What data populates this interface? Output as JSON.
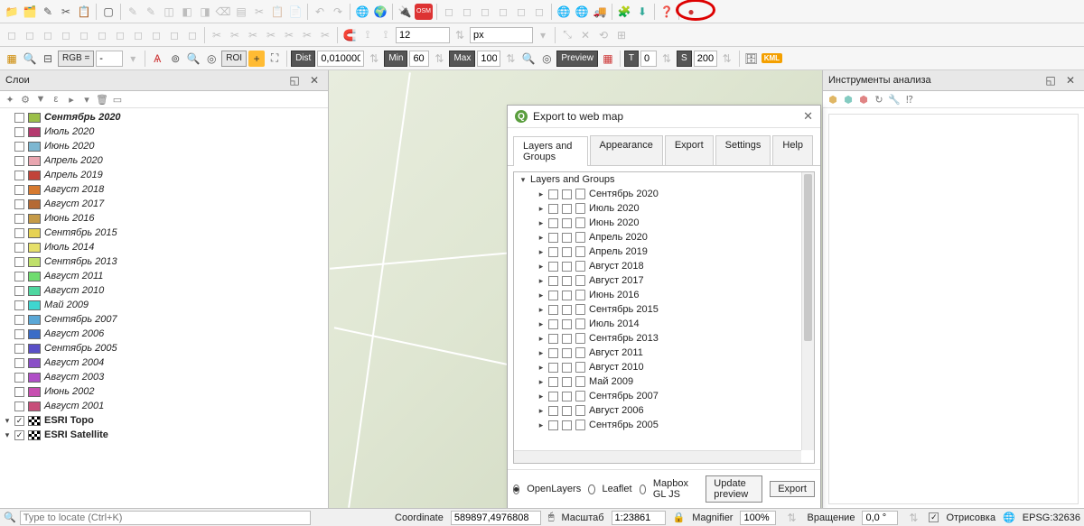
{
  "toolbar1": {
    "spin_value": "12",
    "unit": "px"
  },
  "toolbar3": {
    "rgb_label": "RGB =",
    "roi_label": "ROI",
    "dist_label": "Dist",
    "dist_value": "0,010000",
    "min_label": "Min",
    "min_value": "60",
    "max_label": "Max",
    "max_value": "100",
    "preview_label": "Preview",
    "t_label": "T",
    "t_value": "0",
    "s_label": "S",
    "s_value": "200",
    "kml_label": "KML"
  },
  "layers_panel": {
    "title": "Слои",
    "items": [
      {
        "color": "#9bbf49",
        "name": "Сентябрь 2020",
        "bold": true
      },
      {
        "color": "#b53a6f",
        "name": "Июль 2020"
      },
      {
        "color": "#7db7d1",
        "name": "Июнь 2020"
      },
      {
        "color": "#e9a6b0",
        "name": "Апрель 2020"
      },
      {
        "color": "#c1443a",
        "name": "Апрель 2019"
      },
      {
        "color": "#d67a30",
        "name": "Август 2018"
      },
      {
        "color": "#b56a34",
        "name": "Август 2017"
      },
      {
        "color": "#c59a47",
        "name": "Июнь 2016"
      },
      {
        "color": "#e6d253",
        "name": "Сентябрь 2015"
      },
      {
        "color": "#e6e06a",
        "name": "Июль 2014"
      },
      {
        "color": "#bfe06a",
        "name": "Сентябрь 2013"
      },
      {
        "color": "#6fdc6f",
        "name": "Август 2011"
      },
      {
        "color": "#4fd6a0",
        "name": "Август 2010"
      },
      {
        "color": "#3fd6d0",
        "name": "Май 2009"
      },
      {
        "color": "#5aa7d6",
        "name": "Сентябрь 2007"
      },
      {
        "color": "#3a6cc7",
        "name": "Август 2006"
      },
      {
        "color": "#5a4fc7",
        "name": "Сентябрь 2005"
      },
      {
        "color": "#8a4fc7",
        "name": "Август 2004"
      },
      {
        "color": "#b04fc7",
        "name": "Август 2003"
      },
      {
        "color": "#c74fb0",
        "name": "Июнь 2002"
      },
      {
        "color": "#c74f7a",
        "name": "Август 2001"
      }
    ],
    "base_layers": [
      {
        "name": "ESRI Topo"
      },
      {
        "name": "ESRI Satellite"
      }
    ]
  },
  "right_panel": {
    "title": "Инструменты анализа"
  },
  "dialog": {
    "title": "Export to web map",
    "tabs": [
      "Layers and Groups",
      "Appearance",
      "Export",
      "Settings",
      "Help"
    ],
    "tree_root": "Layers and Groups",
    "tree_items": [
      "Сентябрь 2020",
      "Июль 2020",
      "Июнь 2020",
      "Апрель 2020",
      "Апрель 2019",
      "Август 2018",
      "Август 2017",
      "Июнь 2016",
      "Сентябрь 2015",
      "Июль 2014",
      "Сентябрь 2013",
      "Август 2011",
      "Август 2010",
      "Май 2009",
      "Сентябрь 2007",
      "Август 2006",
      "Сентябрь 2005"
    ],
    "radios": [
      "OpenLayers",
      "Leaflet",
      "Mapbox GL JS"
    ],
    "update_btn": "Update preview",
    "export_btn": "Export"
  },
  "statusbar": {
    "locate_placeholder": "Type to locate (Ctrl+K)",
    "coord_label": "Coordinate",
    "coord_value": "589897,4976808",
    "scale_label": "Масштаб",
    "scale_value": "1:23861",
    "magnifier_label": "Magnifier",
    "magnifier_value": "100%",
    "rotation_label": "Вращение",
    "rotation_value": "0,0 °",
    "render_label": "Отрисовка",
    "epsg": "EPSG:32636"
  }
}
